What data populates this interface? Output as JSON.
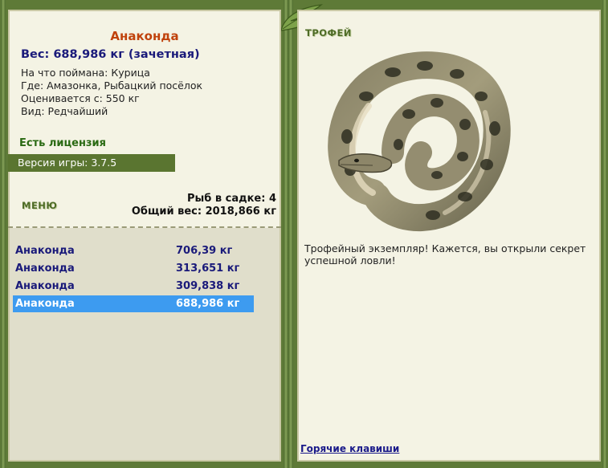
{
  "fish": {
    "name": "Анаконда",
    "weight_line": "Вес: 688,986 кг (зачетная)",
    "bait_line": "На что поймана: Курица",
    "location_line": "Где: Амазонка, Рыбацкий посёлок",
    "value_line": "Оценивается с: 550 кг",
    "rarity_line": "Вид: Редчайший"
  },
  "license": "Есть лицензия",
  "version": "Версия игры: 3.7.5",
  "menu_label": "МЕНЮ",
  "stats": {
    "count_line": "Рыб в садке: 4",
    "total_line": "Общий вес: 2018,866 кг"
  },
  "catches": [
    {
      "name": "Анаконда",
      "weight": "706,39 кг"
    },
    {
      "name": "Анаконда",
      "weight": "313,651 кг"
    },
    {
      "name": "Анаконда",
      "weight": "309,838 кг"
    },
    {
      "name": "Анаконда",
      "weight": "688,986 кг"
    }
  ],
  "selected_catch_index": 3,
  "trophy": {
    "label": "ТРОФЕЙ",
    "description": "Трофейный экземпляр! Кажется, вы открыли секрет успешной ловли!"
  },
  "hotkeys": "Горячие клавиши",
  "colors": {
    "frame": "#5e7a37",
    "panel": "#f4f3e4",
    "title": "#c0420c",
    "navy_text": "#1a1a7a",
    "selection": "#3d9bf0"
  }
}
